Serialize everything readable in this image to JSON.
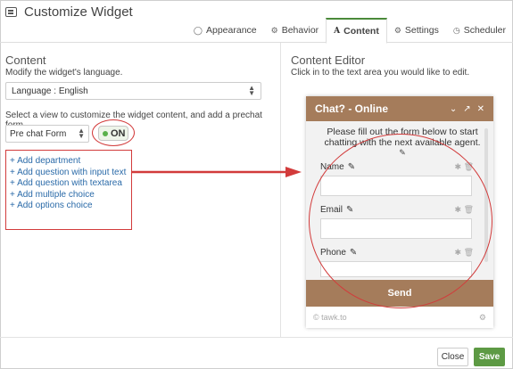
{
  "window": {
    "title": "Customize Widget",
    "icon": "widget-window-icon"
  },
  "tabs": [
    {
      "label": "Appearance",
      "icon": "circle-icon",
      "glyph": "◯",
      "active": false
    },
    {
      "label": "Behavior",
      "icon": "gears-icon",
      "glyph": "⚙",
      "active": false
    },
    {
      "label": "Content",
      "icon": "font-icon",
      "glyph": "A",
      "active": true
    },
    {
      "label": "Settings",
      "icon": "gear-icon",
      "glyph": "⚙",
      "active": false
    },
    {
      "label": "Scheduler",
      "icon": "clock-icon",
      "glyph": "◷",
      "active": false
    }
  ],
  "content": {
    "heading": "Content",
    "subtitle": "Modify the widget's language.",
    "language_select": "Language : English",
    "view_instruction": "Select a view to customize the widget content, and add a prechat form.",
    "view_select": "Pre chat Form",
    "toggle_label": "ON",
    "add_links": [
      "+ Add department",
      "+ Add question with input text",
      "+ Add question with textarea",
      "+ Add multiple choice",
      "+ Add options choice"
    ]
  },
  "editor": {
    "heading": "Content Editor",
    "subtitle": "Click in to the text area you would like to edit.",
    "widget": {
      "title": "Chat? - Online",
      "message": "Please fill out the form below to start chatting with the next available agent.",
      "fields": [
        {
          "label": "Name"
        },
        {
          "label": "Email"
        },
        {
          "label": "Phone"
        }
      ],
      "send_label": "Send",
      "branding": "© tawk.to"
    }
  },
  "footer": {
    "close_label": "Close",
    "save_label": "Save"
  },
  "colors": {
    "accent_green": "#5d9a44",
    "widget_brown": "#a57c5b",
    "annotation_red": "#d23b3b",
    "link_blue": "#2a6aa8"
  }
}
